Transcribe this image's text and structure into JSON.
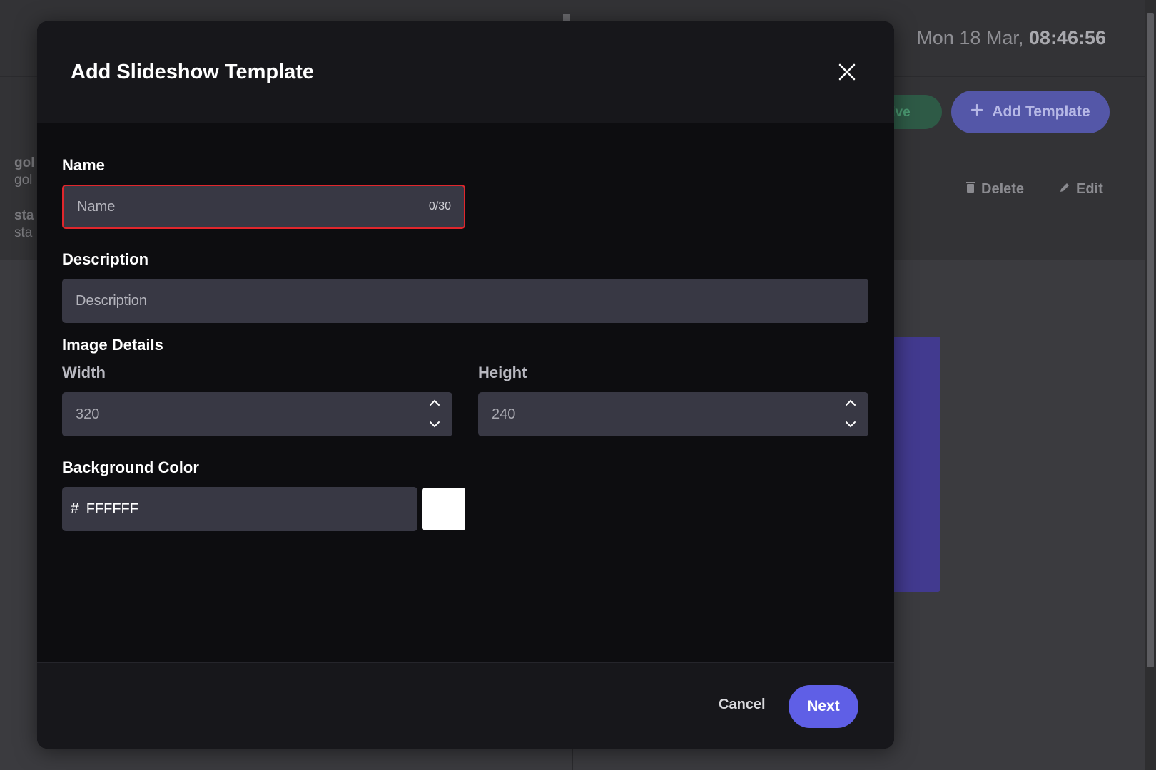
{
  "background": {
    "clock_date": "Mon 18 Mar,",
    "clock_time": "08:46:56",
    "live_label": "live",
    "add_template_label": "Add Template",
    "delete_label": "Delete",
    "edit_label": "Edit",
    "list_items": [
      {
        "title": "gol",
        "subtitle": "gol"
      },
      {
        "title": "sta",
        "subtitle": "sta"
      }
    ]
  },
  "modal": {
    "title": "Add Slideshow Template",
    "name": {
      "label": "Name",
      "placeholder": "Name",
      "counter": "0/30"
    },
    "description": {
      "label": "Description",
      "placeholder": "Description"
    },
    "image_details": {
      "label": "Image Details",
      "width_label": "Width",
      "width_value": "320",
      "height_label": "Height",
      "height_value": "240"
    },
    "background_color": {
      "label": "Background Color",
      "hash": "#",
      "value": "FFFFFF",
      "swatch_color": "#FFFFFF"
    },
    "footer": {
      "cancel_label": "Cancel",
      "next_label": "Next"
    }
  },
  "colors": {
    "accent": "#5F5FE6",
    "error": "#E0262C"
  }
}
